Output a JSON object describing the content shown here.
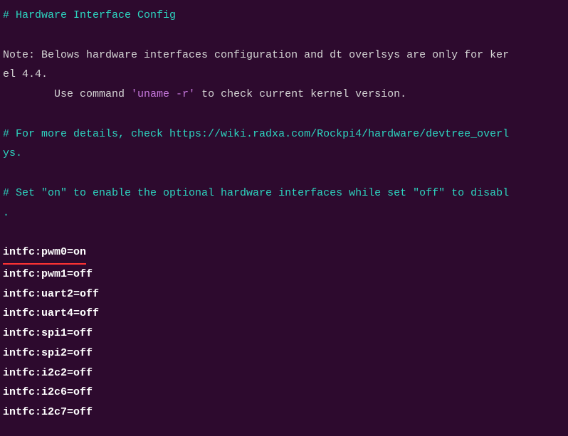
{
  "header_comment": "# Hardware Interface Config",
  "note_line1": "Note: Belows hardware interfaces configuration and dt overlsys are only for ker",
  "note_line2": "el 4.4.",
  "note_line3_prefix": "        Use command ",
  "note_line3_quoted": "'uname -r'",
  "note_line3_suffix": " to check current kernel version.",
  "details_comment_line1": "# For more details, check https://wiki.radxa.com/Rockpi4/hardware/devtree_overl",
  "details_comment_line2": "ys.",
  "enable_comment_line1": "# Set \"on\" to enable the optional hardware interfaces while set \"off\" to disabl",
  "enable_comment_line2": ".",
  "config_lines": [
    {
      "text": "intfc:pwm0=on",
      "highlighted": true
    },
    {
      "text": "intfc:pwm1=off",
      "highlighted": false
    },
    {
      "text": "intfc:uart2=off",
      "highlighted": false
    },
    {
      "text": "intfc:uart4=off",
      "highlighted": false
    },
    {
      "text": "intfc:spi1=off",
      "highlighted": false
    },
    {
      "text": "intfc:spi2=off",
      "highlighted": false
    },
    {
      "text": "intfc:i2c2=off",
      "highlighted": false
    },
    {
      "text": "intfc:i2c6=off",
      "highlighted": false
    },
    {
      "text": "intfc:i2c7=off",
      "highlighted": false
    }
  ]
}
